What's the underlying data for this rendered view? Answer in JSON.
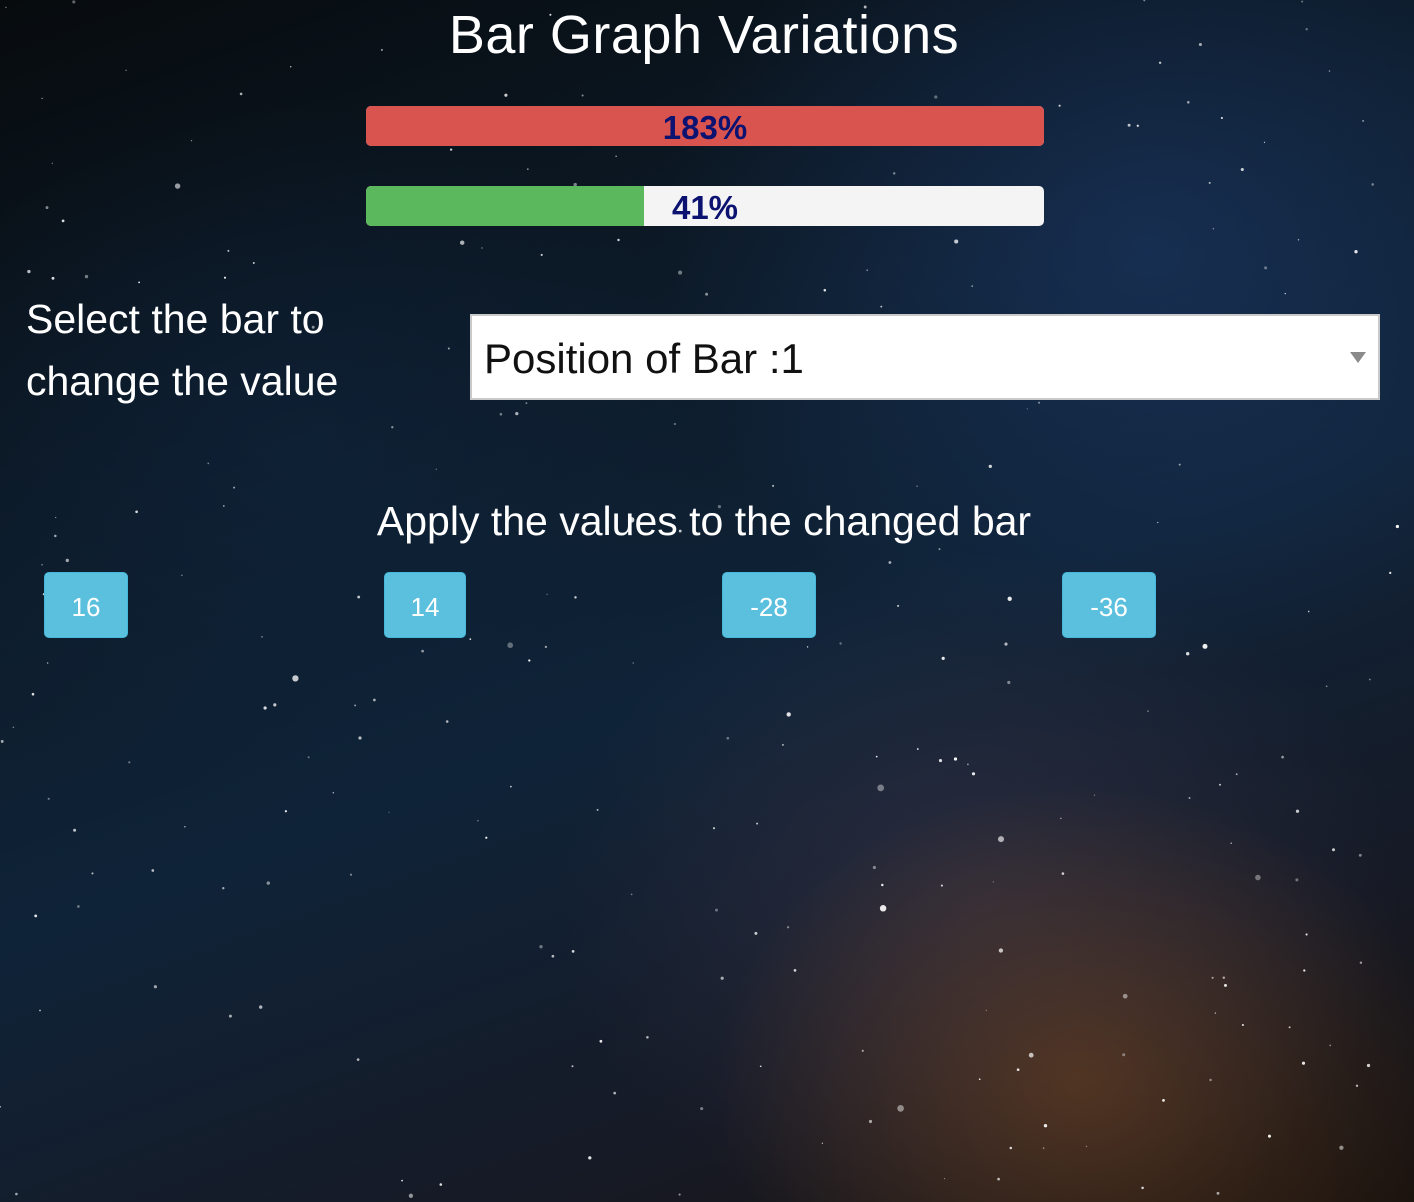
{
  "title": "Bar Graph Variations",
  "bars": [
    {
      "label": "183%",
      "fill_fraction": 1.0,
      "fill_color": "#d9534f"
    },
    {
      "label": "41%",
      "fill_fraction": 0.41,
      "fill_color": "#5cb85c"
    }
  ],
  "bar_track_color": "#f4f4f4",
  "bar_text_color": "#0b1270",
  "select": {
    "label": "Select the bar to change the value",
    "selected": "Position of Bar :1"
  },
  "apply": {
    "heading": "Apply the values to the changed bar",
    "buttons": [
      "16",
      "14",
      "-28",
      "-36"
    ],
    "button_color": "#5bc0de"
  }
}
